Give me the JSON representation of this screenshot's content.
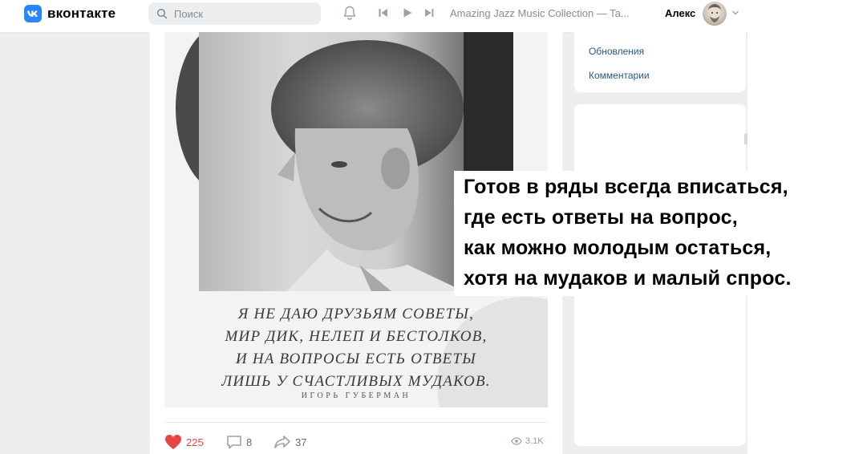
{
  "header": {
    "logo_text": "вконтакте",
    "search": {
      "placeholder": "Поиск"
    },
    "player": {
      "track_title": "Amazing Jazz Music Collection — Ta..."
    },
    "user": {
      "name": "Алекс"
    }
  },
  "post": {
    "quote_lines": [
      "Я НЕ ДАЮ ДРУЗЬЯМ СОВЕТЫ,",
      "МИР ДИК, НЕЛЕП И БЕСТОЛКОВ,",
      "И НА ВОПРОСЫ ЕСТЬ ОТВЕТЫ",
      "ЛИШЬ У СЧАСТЛИВЫХ МУДАКОВ."
    ],
    "author": "ИГОРЬ ГУБЕРМАН",
    "likes": "225",
    "comments": "8",
    "shares": "37",
    "views": "3.1K"
  },
  "sidebar_menu": {
    "items": [
      "Обновления",
      "Комментарии"
    ]
  },
  "caption": {
    "lines": [
      "Готов в ряды всегда вписаться,",
      "где есть ответы на  вопрос,",
      "как можно молодым остаться,",
      "хотя на мудаков и малый спрос."
    ]
  },
  "colors": {
    "brand": "#2787f5",
    "like": "#e64646",
    "link": "#2a5885",
    "page_bg": "#edeef0"
  }
}
